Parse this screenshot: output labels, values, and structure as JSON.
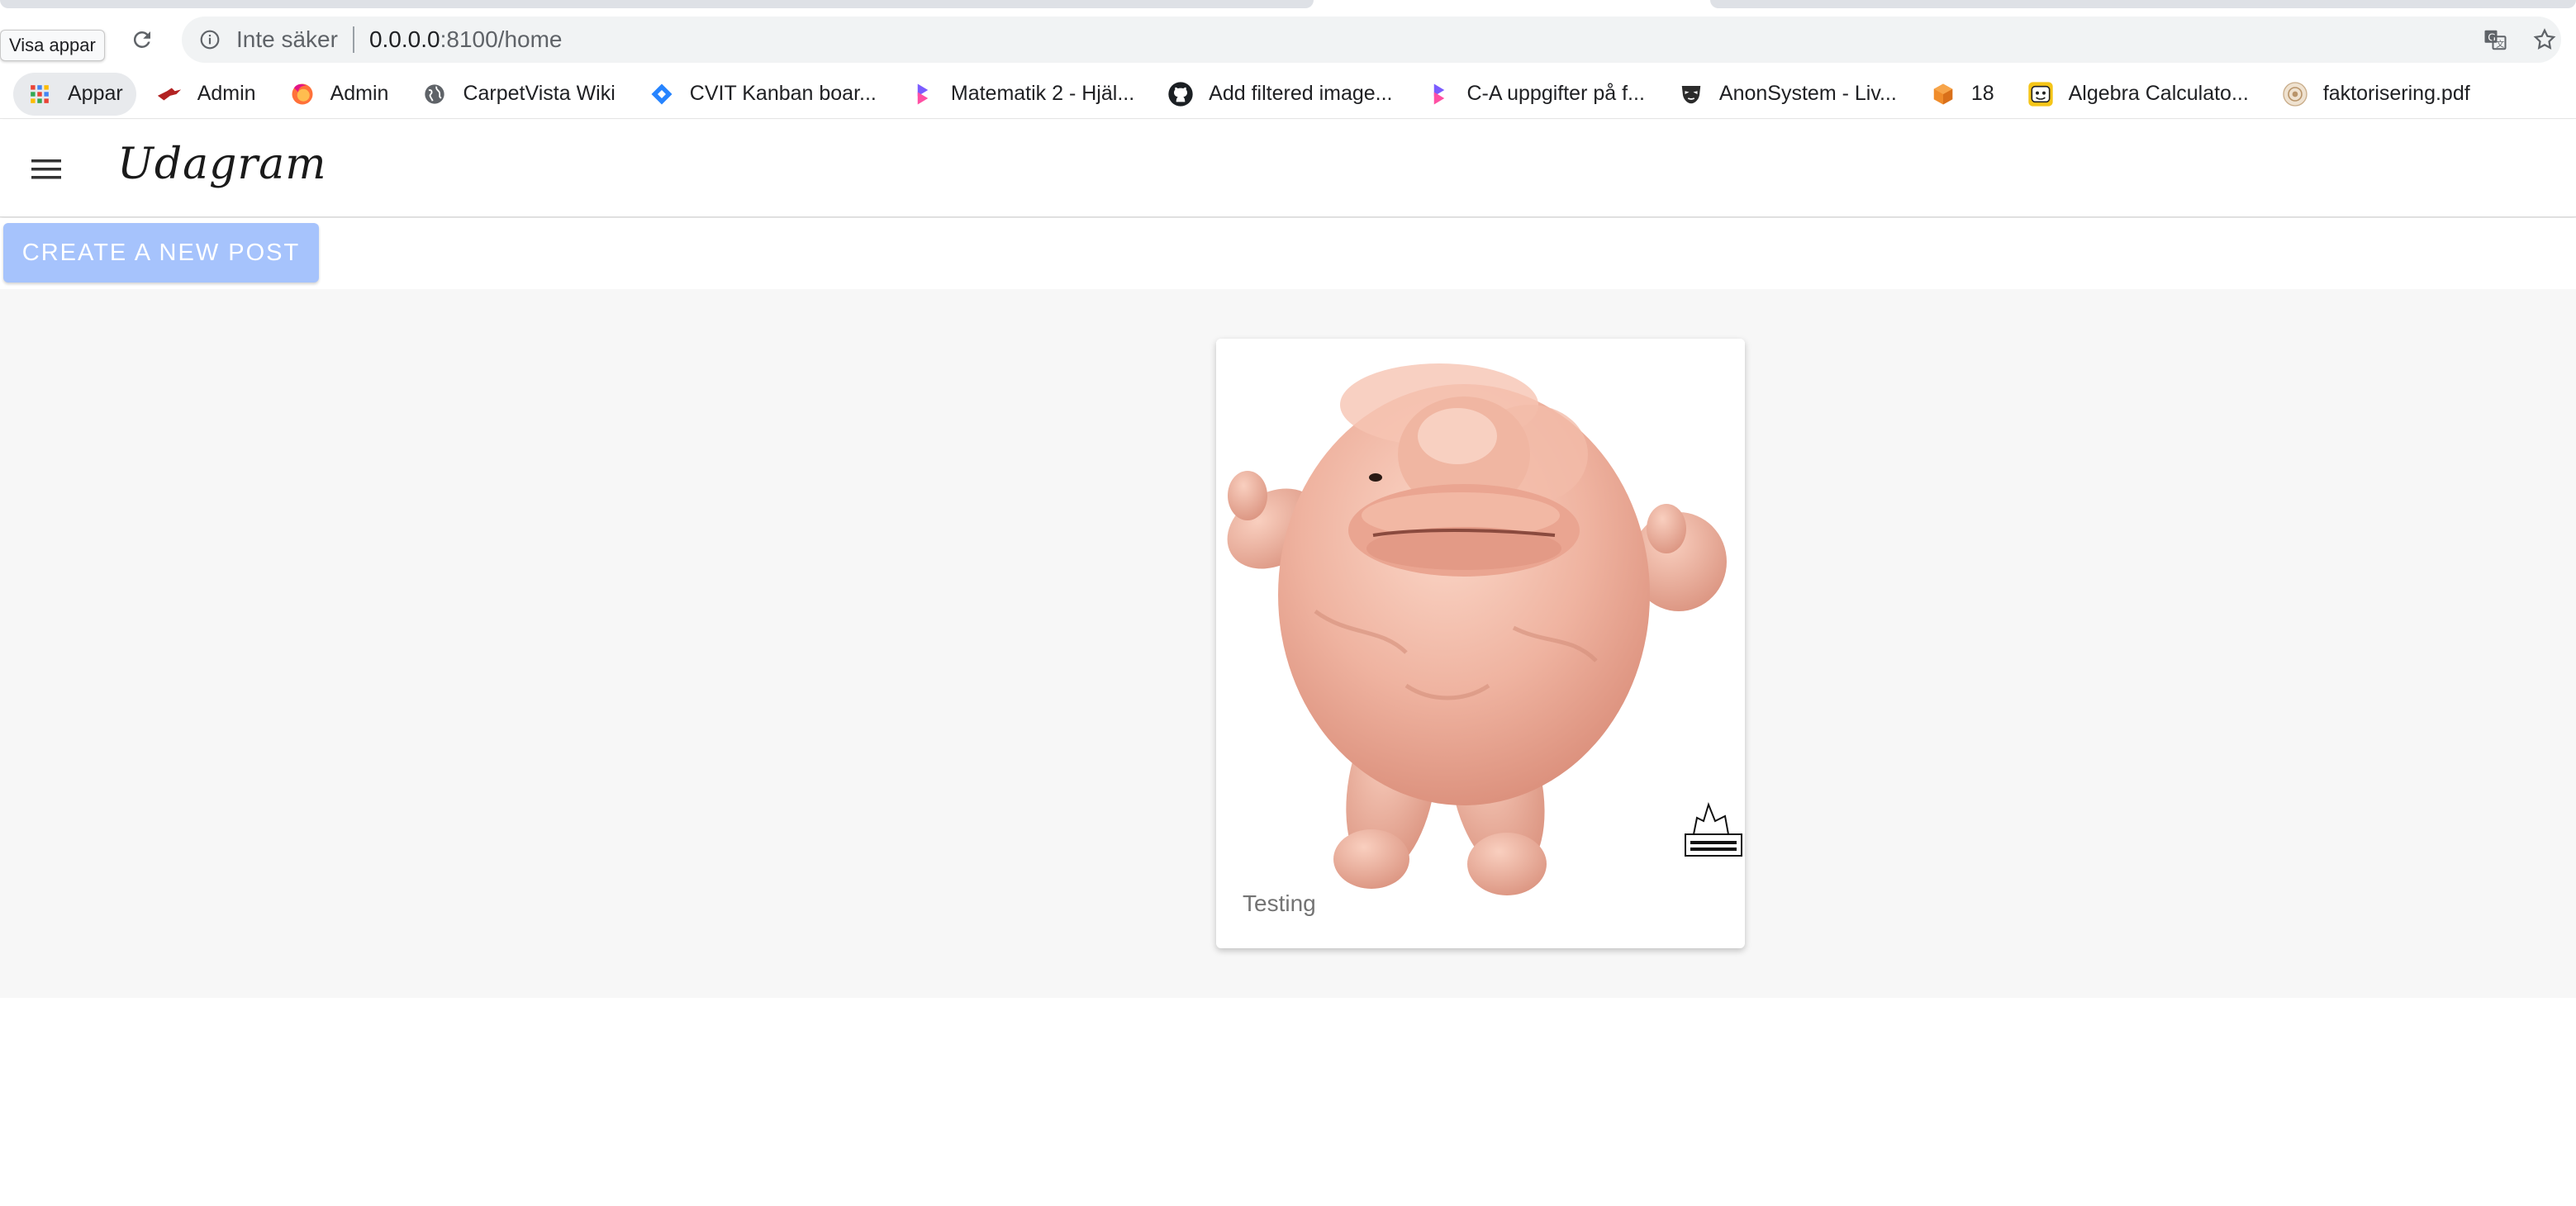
{
  "browser": {
    "tooltip": "Visa appar",
    "security_label": "Inte säker",
    "url_host": "0.0.0.0",
    "url_path": ":8100/home"
  },
  "bookmarks": [
    {
      "label": "Appar",
      "icon": "apps-grid-icon"
    },
    {
      "label": "Admin",
      "icon": "bird-icon"
    },
    {
      "label": "Admin",
      "icon": "firefox-icon"
    },
    {
      "label": "CarpetVista Wiki",
      "icon": "globe-icon"
    },
    {
      "label": "CVIT Kanban boar...",
      "icon": "jira-icon"
    },
    {
      "label": "Matematik 2 - Hjäl...",
      "icon": "bookmark-flag-icon"
    },
    {
      "label": "Add filtered image...",
      "icon": "github-icon"
    },
    {
      "label": "C-A uppgifter på f...",
      "icon": "bookmark-flag-icon"
    },
    {
      "label": "AnonSystem - Liv...",
      "icon": "mask-icon"
    },
    {
      "label": "18",
      "icon": "cube-icon"
    },
    {
      "label": "Algebra Calculato...",
      "icon": "calculator-icon"
    },
    {
      "label": "faktorisering.pdf",
      "icon": "pdf-icon"
    }
  ],
  "app": {
    "title": "Udagram",
    "create_button": "CREATE A NEW POST"
  },
  "feed": {
    "items": [
      {
        "caption": "Testing",
        "image": "pink-creature-figurine"
      }
    ]
  },
  "colors": {
    "create_button_bg": "#a6c3fc",
    "feed_bg": "#f7f7f7",
    "omnibox_bg": "#f1f3f4"
  }
}
